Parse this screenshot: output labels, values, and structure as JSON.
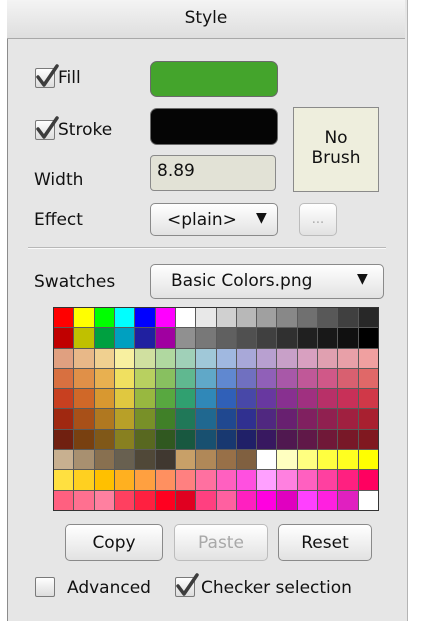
{
  "header": {
    "title": "Style"
  },
  "fill": {
    "label": "Fill",
    "checked": true,
    "color": "#44a42c"
  },
  "stroke": {
    "label": "Stroke",
    "checked": true,
    "color": "#050505"
  },
  "width": {
    "label": "Width",
    "value": "8.89"
  },
  "brush": {
    "line1": "No",
    "line2": "Brush"
  },
  "effect": {
    "label": "Effect",
    "selected": "<plain>",
    "more_label": "..."
  },
  "swatches": {
    "label": "Swatches",
    "selected": "Basic Colors.png",
    "rows": [
      [
        "#ff0000",
        "#ffff00",
        "#00ff00",
        "#00ffff",
        "#0000ff",
        "#ff00ff",
        "#ffffff",
        "#e8e8e8",
        "#d0d0d0",
        "#b8b8b8",
        "#a0a0a0",
        "#888888",
        "#707070",
        "#585858",
        "#404040",
        "#282828"
      ],
      [
        "#c00000",
        "#c0c000",
        "#00a040",
        "#00a0c0",
        "#2020a0",
        "#a000a0",
        "#909090",
        "#787878",
        "#606060",
        "#505050",
        "#404040",
        "#303030",
        "#202020",
        "#181818",
        "#101010",
        "#000000"
      ],
      [
        "#e0a080",
        "#e8b888",
        "#f0d090",
        "#f8f0a0",
        "#d0e0a0",
        "#b0d8a0",
        "#a0d0b8",
        "#a0c8d8",
        "#a0b8e0",
        "#a8a8d8",
        "#b8a0d0",
        "#c8a0c8",
        "#d8a0c0",
        "#e0a0b0",
        "#e8a0a8",
        "#f0a0a0"
      ],
      [
        "#d87040",
        "#e09048",
        "#e8b050",
        "#f0e060",
        "#b8d060",
        "#88c060",
        "#60b890",
        "#60a8c8",
        "#6088d0",
        "#7070c0",
        "#9060b8",
        "#a858a8",
        "#c05898",
        "#d05888",
        "#d86070",
        "#e06868"
      ],
      [
        "#c84020",
        "#d06828",
        "#d89830",
        "#e0c840",
        "#98b840",
        "#58a840",
        "#30a070",
        "#3088b8",
        "#3060b8",
        "#4848a8",
        "#6838a0",
        "#883090",
        "#a03080",
        "#b83068",
        "#c83058",
        "#d03848"
      ],
      [
        "#a02810",
        "#a85018",
        "#b07820",
        "#b8a028",
        "#789028",
        "#408028",
        "#207858",
        "#206890",
        "#204890",
        "#303090",
        "#502880",
        "#682070",
        "#802060",
        "#902050",
        "#a02040",
        "#a82030"
      ],
      [
        "#702010",
        "#784010",
        "#805818",
        "#888020",
        "#586820",
        "#305820",
        "#185840",
        "#185070",
        "#183870",
        "#202068",
        "#381860",
        "#501850",
        "#601848",
        "#701838",
        "#781828",
        "#801820"
      ],
      [
        "#c8b090",
        "#a89070",
        "#887050",
        "#686050",
        "#504838",
        "#403830",
        "#c8a068",
        "#b08858",
        "#987048",
        "#806040",
        "#ffffff",
        "#ffffc0",
        "#ffff80",
        "#ffff40",
        "#ffff20",
        "#ffff00"
      ],
      [
        "#ffe040",
        "#ffd020",
        "#ffc000",
        "#ffb020",
        "#ffa040",
        "#ff9060",
        "#ff8080",
        "#ff70a0",
        "#ff60c0",
        "#ff50e0",
        "#ffa0ff",
        "#ff80e0",
        "#ff60c0",
        "#ff40a0",
        "#ff2080",
        "#ff0060"
      ],
      [
        "#ff6080",
        "#ff7090",
        "#ff80a0",
        "#ff4060",
        "#ff2040",
        "#ff0020",
        "#e00020",
        "#ff4080",
        "#ff60a0",
        "#ff20c0",
        "#ff00e0",
        "#e000c0",
        "#ff40ff",
        "#ff20e0",
        "#e020c0",
        "#ffffff"
      ]
    ]
  },
  "actions": {
    "copy": "Copy",
    "paste": "Paste",
    "reset": "Reset"
  },
  "options": {
    "advanced": {
      "label": "Advanced",
      "checked": false
    },
    "checker": {
      "label": "Checker selection",
      "checked": true
    }
  }
}
